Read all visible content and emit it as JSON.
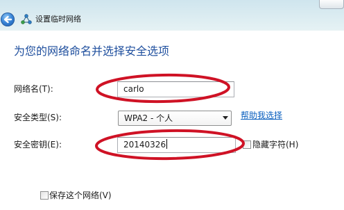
{
  "header": {
    "title": "设置临时网络",
    "back_icon": "back-arrow-icon",
    "title_icon": "network-icon"
  },
  "main": {
    "heading": "为您的网络命名并选择安全选项",
    "network_name": {
      "label": "网络名(T):",
      "value": "carlo"
    },
    "security_type": {
      "label": "安全类型(S):",
      "selected": "WPA2 - 个人",
      "help_link": "帮助我选择"
    },
    "security_key": {
      "label": "安全密钥(E):",
      "value": "20140326",
      "hide_chars": {
        "label": "隐藏字符(H)",
        "checked": false
      }
    },
    "save_network": {
      "label": "保存这个网络(V)",
      "checked": false
    }
  },
  "colors": {
    "heading": "#1f4f9e",
    "link": "#0a5fbf",
    "highlight": "#cf1225",
    "header_top": "#cfe5ee",
    "header_bottom": "#e6f2f4"
  }
}
